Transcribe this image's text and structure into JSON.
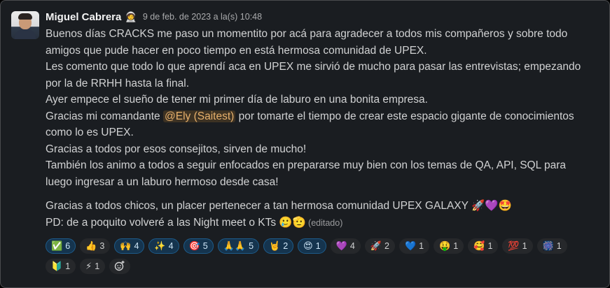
{
  "message": {
    "author": "Miguel Cabrera",
    "status_emoji": "🧑‍🚀",
    "timestamp": "9 de feb. de 2023 a la(s) 10:48",
    "lines": [
      "Buenos días CRACKS me paso un momentito por acá para agradecer a todos mis compañeros y sobre todo",
      "amigos que pude hacer en poco tiempo en está hermosa comunidad de UPEX.",
      "Les comento que todo lo que aprendí aca en UPEX me sirvió de mucho para pasar las entrevistas; empezando",
      "por la de RRHH hasta la final.",
      "Ayer empece el sueño de tener mi primer día de laburo en una bonita empresa."
    ],
    "thanks_prefix": "Gracias mi comandante ",
    "mention": "@Ely (Saitest)",
    "thanks_suffix": " por tomarte el tiempo de crear este espacio gigante de conocimientos",
    "lines_after": [
      "como lo es UPEX.",
      "Gracias a todos por esos consejitos, sirven de mucho!",
      "También los animo a todos a seguir enfocados en prepararse muy bien con los temas de QA, API, SQL para",
      "luego ingresar a un laburo hermoso desde casa!"
    ],
    "closing_line": "Gracias a todos chicos, un placer pertenecer a tan hermosa comunidad UPEX GALAXY 🚀💜🤩",
    "ps_line": "PD: de a poquito volveré a las Night meet o KTs 🥲🫡",
    "edited_label": "(editado)"
  },
  "reactions": [
    {
      "emoji": "✅",
      "count": "6",
      "active": true
    },
    {
      "emoji": "👍",
      "count": "3",
      "active": false
    },
    {
      "emoji": "🙌",
      "count": "4",
      "active": true
    },
    {
      "emoji": "✨",
      "count": "4",
      "active": true
    },
    {
      "emoji": "🎯",
      "count": "5",
      "active": true
    },
    {
      "emoji": "🙏🙏",
      "count": "5",
      "active": true
    },
    {
      "emoji": "🤘",
      "count": "2",
      "active": true
    },
    {
      "emoji": "😍",
      "count": "1",
      "active": true
    },
    {
      "emoji": "💜",
      "count": "4",
      "active": false
    },
    {
      "emoji": "🚀",
      "count": "2",
      "active": false
    },
    {
      "emoji": "💙",
      "count": "1",
      "active": false
    },
    {
      "emoji": "🤑",
      "count": "1",
      "active": false
    },
    {
      "emoji": "🥰",
      "count": "1",
      "active": false
    },
    {
      "emoji": "💯",
      "count": "1",
      "active": false
    },
    {
      "emoji": "🎆",
      "count": "1",
      "active": false
    },
    {
      "emoji": "🔰",
      "count": "1",
      "active": false
    },
    {
      "emoji": "⚡",
      "count": "1",
      "active": false
    }
  ],
  "add_reaction_icon": "add-emoji-icon",
  "colors": {
    "background": "#1a1d21",
    "text": "#d1d2d3",
    "mention_bg": "#3d3223",
    "mention_text": "#e8b16c",
    "reaction_active_bg": "#15344e",
    "reaction_active_border": "#1d5b8a"
  }
}
